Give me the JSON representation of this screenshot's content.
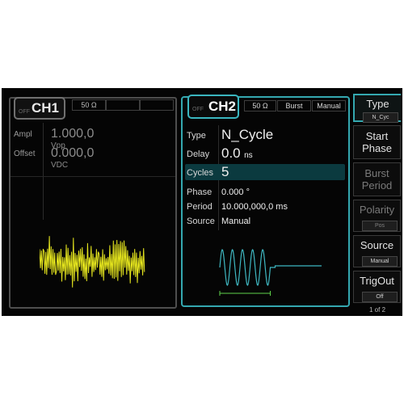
{
  "ch1": {
    "title": "CH1",
    "off": "OFF",
    "impedance": "50 Ω",
    "params": [
      {
        "label": "Ampl",
        "value": "1.000,0",
        "unit": "Vpp"
      },
      {
        "label": "Offset",
        "value": "0.000,0",
        "unit": "VDC"
      }
    ]
  },
  "ch2": {
    "title": "CH2",
    "off": "OFF",
    "impedance": "50 Ω",
    "mode": "Burst",
    "trigger": "Manual",
    "params": {
      "type": {
        "label": "Type",
        "value": "N_Cycle"
      },
      "delay": {
        "label": "Delay",
        "value": "0.0",
        "unit": "ns"
      },
      "cycles": {
        "label": "Cycles",
        "value": "5"
      },
      "phase": {
        "label": "Phase",
        "value": "0.000 °"
      },
      "period": {
        "label": "Period",
        "value": "10.000,000,0 ms"
      },
      "source": {
        "label": "Source",
        "value": "Manual"
      }
    }
  },
  "softkeys": {
    "type": {
      "label": "Type",
      "value": "N_Cyc"
    },
    "start_phase": {
      "line1": "Start",
      "line2": "Phase"
    },
    "burst_period": {
      "line1": "Burst",
      "line2": "Period"
    },
    "polarity": {
      "label": "Polarity",
      "value": "Pos"
    },
    "source": {
      "label": "Source",
      "value": "Manual"
    },
    "trigout": {
      "label": "TrigOut",
      "value": "Off"
    },
    "page": "1 of 2"
  },
  "colors": {
    "accent": "#34a8b0",
    "ch1_wave": "#e6e61e",
    "ch2_wave": "#3fb8c2",
    "marker": "#5fd24a"
  }
}
